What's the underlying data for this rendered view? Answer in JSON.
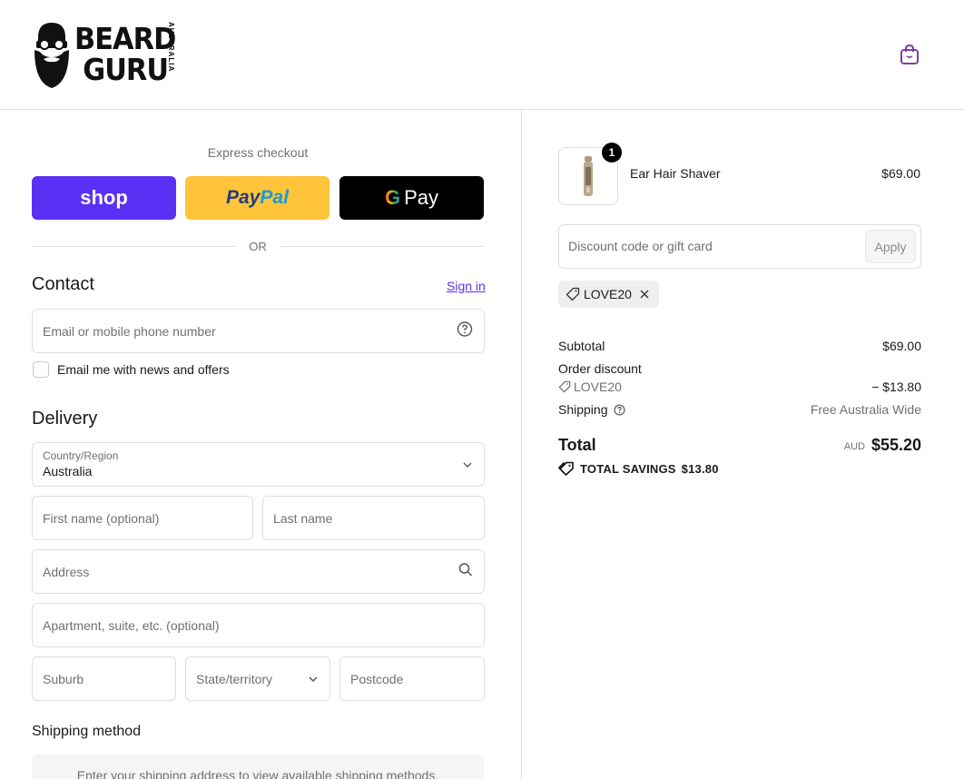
{
  "header": {
    "logo_line1": "BEARD",
    "logo_line2": "GURU",
    "logo_side": "AUSTRALIA",
    "cart_icon": "shopping-bag-icon"
  },
  "express": {
    "label": "Express checkout",
    "shop_label": "shop",
    "paypal_a": "Pay",
    "paypal_b": "Pal",
    "gpay_g": "G",
    "gpay_label": "Pay",
    "or_label": "OR"
  },
  "contact": {
    "title": "Contact",
    "sign_in": "Sign in",
    "email_placeholder": "Email or mobile phone number",
    "newsletter_label": "Email me with news and offers",
    "newsletter_checked": false
  },
  "delivery": {
    "title": "Delivery",
    "country_label": "Country/Region",
    "country_value": "Australia",
    "first_name_placeholder": "First name (optional)",
    "last_name_placeholder": "Last name",
    "address_placeholder": "Address",
    "apartment_placeholder": "Apartment, suite, etc. (optional)",
    "suburb_placeholder": "Suburb",
    "state_placeholder": "State/territory",
    "postcode_placeholder": "Postcode"
  },
  "shipping": {
    "title": "Shipping method",
    "message": "Enter your shipping address to view available shipping methods."
  },
  "order": {
    "product_name": "Ear Hair Shaver",
    "product_price": "$69.00",
    "quantity": "1",
    "discount_placeholder": "Discount code or gift card",
    "apply_label": "Apply",
    "applied_code": "LOVE20"
  },
  "summary": {
    "subtotal_label": "Subtotal",
    "subtotal_value": "$69.00",
    "order_discount_label": "Order discount",
    "discount_code": "LOVE20",
    "discount_value": "− $13.80",
    "shipping_label": "Shipping",
    "shipping_value": "Free Australia Wide",
    "total_label": "Total",
    "currency": "AUD",
    "total_value": "$55.20",
    "savings_label": "TOTAL SAVINGS",
    "savings_value": "$13.80"
  },
  "colors": {
    "shop_purple": "#5a31f4",
    "paypal_yellow": "#ffc439",
    "gpay_black": "#000000",
    "border": "#dedede"
  }
}
